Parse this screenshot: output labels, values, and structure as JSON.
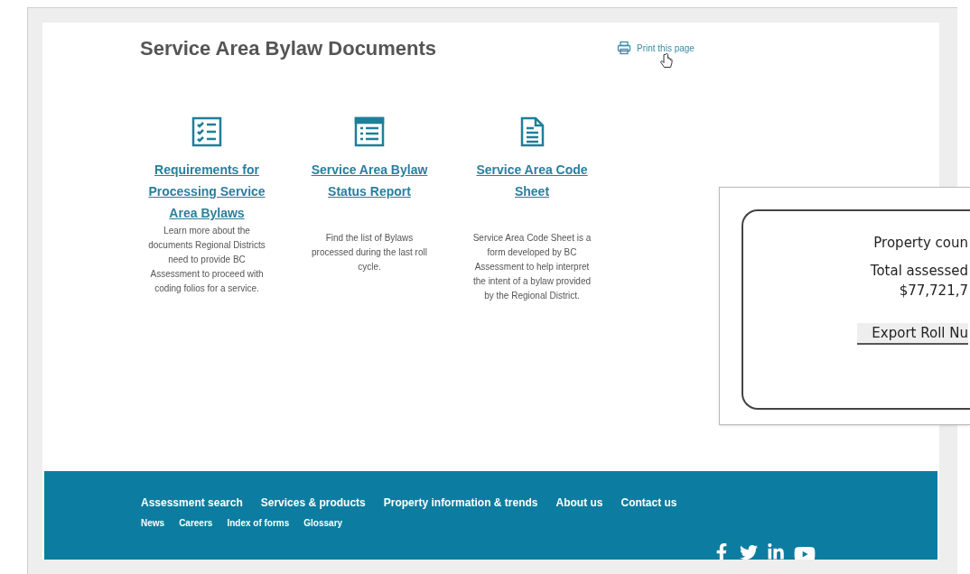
{
  "page_title": "Service Area Bylaw Documents",
  "print_link": "Print this page",
  "documents": [
    {
      "kind": "checklist",
      "title": "Requirements for Processing Service Area Bylaws",
      "description": "Learn more about the documents Regional Districts need to provide BC Assessment to proceed with coding folios for a service."
    },
    {
      "kind": "list",
      "title": "Service Area Bylaw Status Report",
      "description": "Find the list of Bylaws processed during the last roll cycle."
    },
    {
      "kind": "document",
      "title": "Service Area Code Sheet",
      "description": "Service Area Code Sheet is a form developed by BC Assessment to help interpret the intent of a bylaw provided by the Regional District."
    }
  ],
  "popup": {
    "lines": [
      "Property coun",
      "Total assessed",
      "$77,721,7"
    ],
    "button": "Export Roll Nu"
  },
  "footer": {
    "main_links": [
      "Assessment search",
      "Services & products",
      "Property information & trends",
      "About us",
      "Contact us"
    ],
    "secondary_links": [
      "News",
      "Careers",
      "Index of forms",
      "Glossary"
    ]
  }
}
